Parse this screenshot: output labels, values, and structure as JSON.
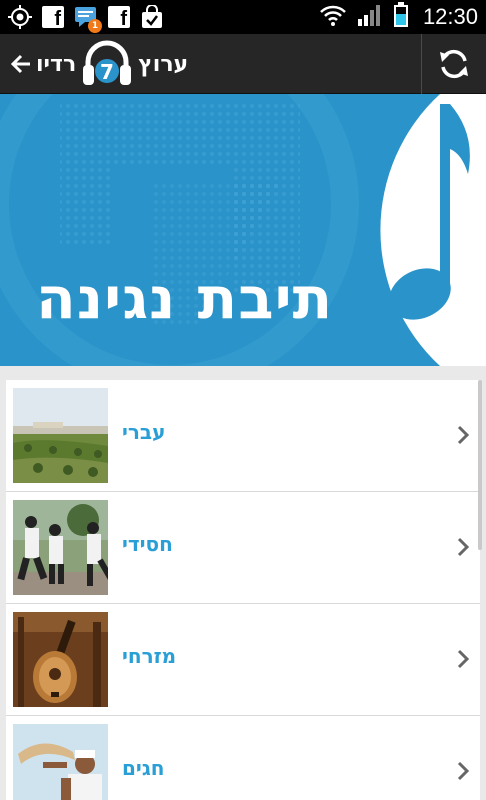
{
  "status_bar": {
    "time": "12:30",
    "notification_badge": "1",
    "icons": [
      "location-target-icon",
      "facebook-icon",
      "chat-notification-icon",
      "facebook-icon",
      "shopping-bag-check-icon",
      "wifi-icon",
      "signal-icon",
      "battery-icon"
    ]
  },
  "action_bar": {
    "back_label": "רדיו",
    "logo_number": "7",
    "channel_label": "ערוץ",
    "refresh_icon": "refresh-icon"
  },
  "banner": {
    "title": "תיבת נגינה",
    "colors": {
      "background": "#2a93c9",
      "circle": "#ffffff",
      "note": "#2a93c9"
    }
  },
  "list": {
    "items": [
      {
        "label": "עברי"
      },
      {
        "label": "חסידי"
      },
      {
        "label": "מזרחי"
      },
      {
        "label": "חגים"
      }
    ]
  },
  "colors": {
    "accent": "#2a9fd6",
    "action_bar": "#262626"
  }
}
